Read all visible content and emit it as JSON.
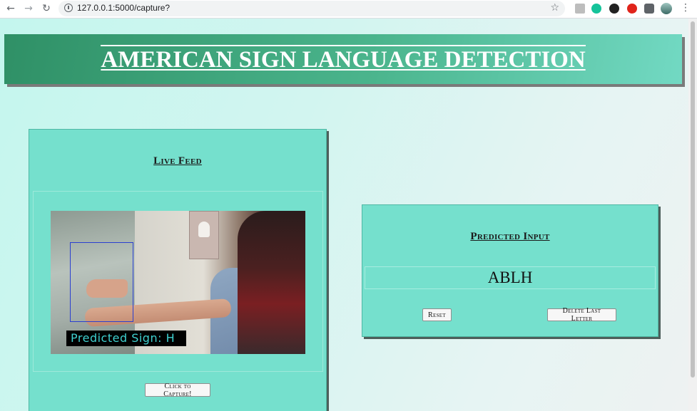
{
  "browser": {
    "url": "127.0.0.1:5000/capture?",
    "back_icon": "←",
    "forward_icon": "→",
    "reload_icon": "↻",
    "star_icon": "☆",
    "menu_icon": "⋮"
  },
  "header": {
    "title": "AMERICAN SIGN LANGUAGE DETECTION"
  },
  "live_feed": {
    "title": "Live Feed",
    "overlay_label": "Predicted Sign: H",
    "capture_button": "Click to Capture!"
  },
  "prediction": {
    "title": "Predicted Input",
    "value": "ABLH",
    "reset_button": "Reset",
    "delete_button": "Delete Last Letter"
  },
  "colors": {
    "panel": "#75e0cd",
    "banner_start": "#2f9066",
    "banner_end": "#72d9c3",
    "background": "#c4f6ee"
  }
}
